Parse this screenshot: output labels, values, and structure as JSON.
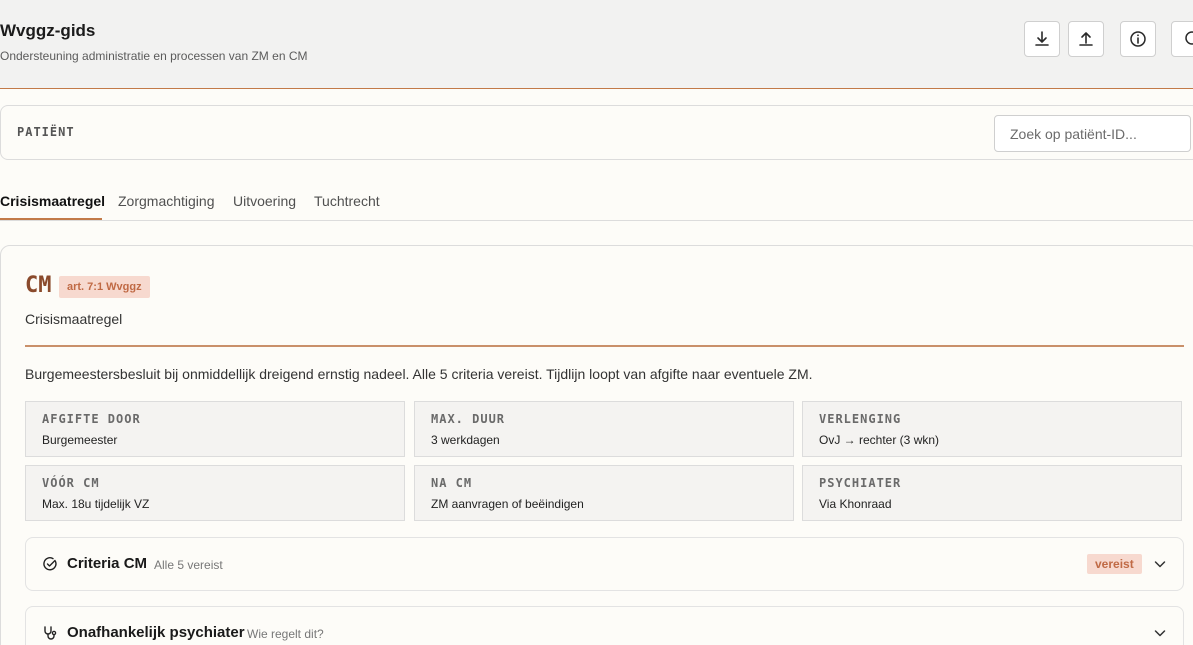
{
  "header": {
    "title": "Wvggz-gids",
    "subtitle": "Ondersteuning administratie en processen van ZM en CM",
    "buttons": [
      {
        "icon": "download-icon"
      },
      {
        "icon": "upload-icon"
      },
      {
        "icon": "info-icon"
      },
      {
        "icon": "search-icon"
      }
    ]
  },
  "patient": {
    "label": "PATIËNT",
    "search_placeholder": "Zoek op patiënt-ID..."
  },
  "tabs": [
    {
      "label": "Crisismaatregel",
      "active": true
    },
    {
      "label": "Zorgmachtiging",
      "active": false
    },
    {
      "label": "Uitvoering",
      "active": false
    },
    {
      "label": "Tuchtrecht",
      "active": false
    }
  ],
  "measure": {
    "code": "CM",
    "badge": "art. 7:1 Wvggz",
    "name": "Crisismaatregel",
    "description": "Burgemeestersbesluit bij onmiddellijk dreigend ernstig nadeel. Alle 5 criteria vereist. Tijdlijn loopt van afgifte naar eventuele ZM.",
    "facts": [
      {
        "label": "AFGIFTE DOOR",
        "value": "Burgemeester"
      },
      {
        "label": "MAX. DUUR",
        "value": "3 werkdagen"
      },
      {
        "label": "VERLENGING",
        "value": "OvJ → rechter (3 wkn)"
      },
      {
        "label": "VÓÓR CM",
        "value": "Max. 18u tijdelijk VZ"
      },
      {
        "label": "NA CM",
        "value": "ZM aanvragen of beëindigen"
      },
      {
        "label": "PSYCHIATER",
        "value": "Via Khonraad"
      }
    ],
    "sections": [
      {
        "icon": "check-circle-icon",
        "title": "Criteria CM",
        "subtitle": "Alle 5 vereist",
        "badge": "vereist"
      },
      {
        "icon": "stethoscope-icon",
        "title": "Onafhankelijk psychiater",
        "subtitle": "Wie regelt dit?",
        "badge": ""
      }
    ]
  },
  "colors": {
    "accent": "#c27a48",
    "code": "#8a4a2c",
    "badge_bg": "#f7d9cf",
    "badge_text": "#c06a45"
  }
}
